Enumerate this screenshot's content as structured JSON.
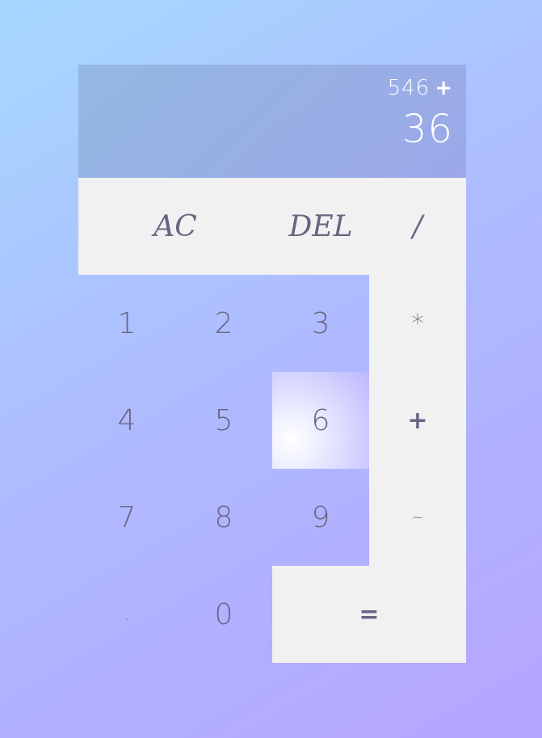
{
  "display": {
    "previous_operand": "546",
    "operation": "+",
    "current_operand": "36"
  },
  "buttons": {
    "ac": "AC",
    "del": "DEL",
    "divide": "/",
    "multiply": "*",
    "add": "+",
    "subtract": "~",
    "equals": "=",
    "one": "1",
    "two": "2",
    "three": "3",
    "four": "4",
    "five": "5",
    "six": "6",
    "seven": "7",
    "eight": "8",
    "nine": "9",
    "dot": ".",
    "zero": "0"
  },
  "colors": {
    "display_text": "#ffffff",
    "button_light": "#f1f1f1",
    "button_text": "#6a6480"
  }
}
